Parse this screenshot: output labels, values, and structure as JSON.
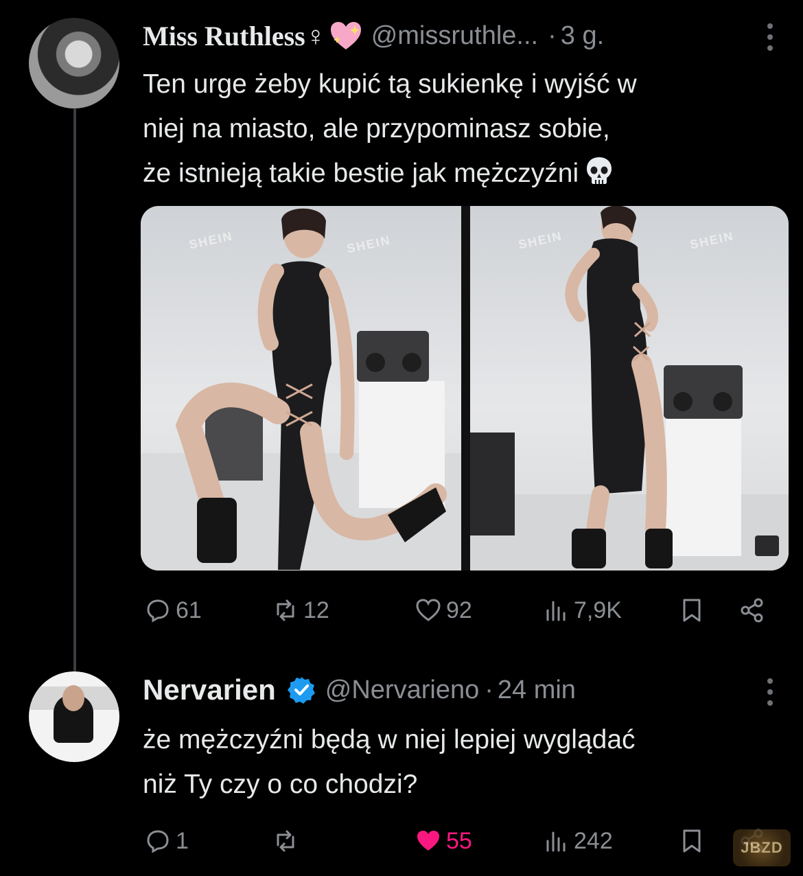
{
  "thread": {
    "tweet1": {
      "display_name": "Miss Ruthless♀",
      "handle": "@missruthle...",
      "separator": "·",
      "time": "3 g.",
      "text": "Ten urge żeby kupić tą sukienkę i wyjść w\nniej na miasto, ale przypominasz sobie,\nże istnieją takie bestie jak mężczyźni",
      "watermark": "SHEIN",
      "actions": {
        "replies": "61",
        "reposts": "12",
        "likes": "92",
        "views": "7,9K"
      }
    },
    "tweet2": {
      "display_name": "Nervarien",
      "handle": "@Nervarieno",
      "separator": "·",
      "time": "24 min",
      "text": "że mężczyźni będą w niej lepiej wyglądać\nniż Ty czy o co chodzi?",
      "actions": {
        "replies": "1",
        "reposts": "",
        "likes": "55",
        "views": "242"
      }
    }
  },
  "watermark_logo": "JBZD",
  "colors": {
    "background": "#000000",
    "text": "#e7e9ea",
    "muted": "#8b8f94",
    "like": "#f91880",
    "verified": "#1d9bf0"
  }
}
